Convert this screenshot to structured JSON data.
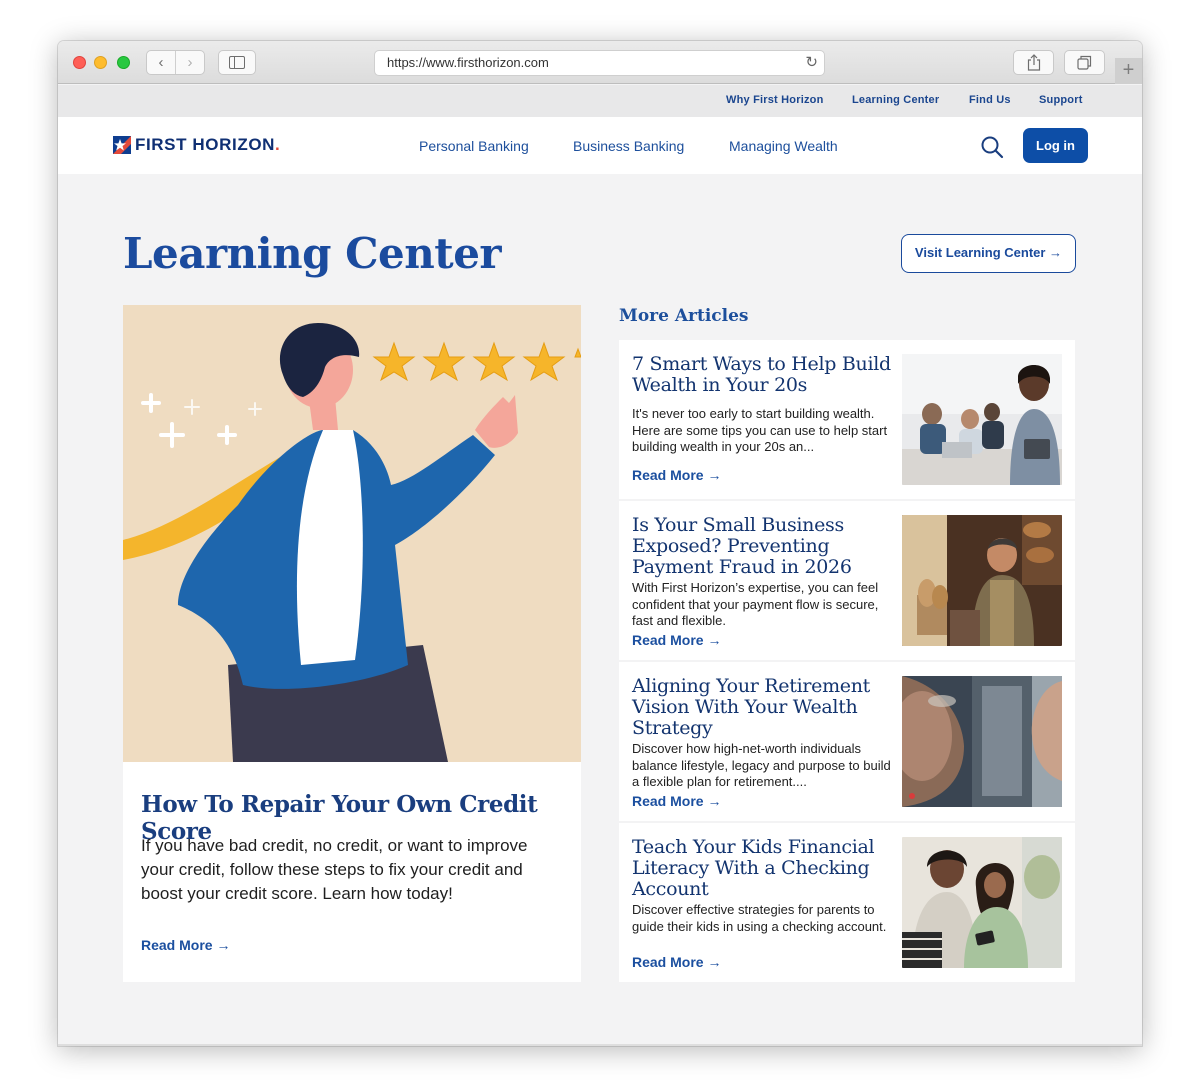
{
  "browser": {
    "url": "https://www.firsthorizon.com",
    "new_tab_glyph": "+"
  },
  "utility_nav": [
    {
      "label": "Why First Horizon"
    },
    {
      "label": "Learning Center"
    },
    {
      "label": "Find Us"
    },
    {
      "label": "Support"
    }
  ],
  "header": {
    "logo_text": "FIRST HORIZON",
    "logo_suffix": ".",
    "nav": [
      {
        "label": "Personal Banking"
      },
      {
        "label": "Business Banking"
      },
      {
        "label": "Managing Wealth"
      }
    ],
    "login_label": "Log in"
  },
  "learning_center": {
    "title": "Learning Center",
    "visit_label": "Visit Learning Center →",
    "featured": {
      "title": "How To Repair Your Own Credit Score",
      "description": "If you have bad credit, no credit, or want to improve your credit, follow these steps to fix your credit and boost your credit score. Learn how today!",
      "read_more": "Read More →",
      "rating_stars": 5
    },
    "more_title": "More Articles",
    "articles": [
      {
        "title": "7 Smart Ways to Help Build Wealth in Your 20s",
        "description": "It's never too early to start building wealth. Here are some tips you can use to help start building wealth in your 20s an...",
        "read_more": "Read More →"
      },
      {
        "title": "Is Your Small Business Exposed? Preventing Payment Fraud in 2026",
        "description": "With First Horizon’s expertise, you can feel confident that your payment flow is secure, fast and flexible.",
        "read_more": "Read More →"
      },
      {
        "title": "Aligning Your Retirement Vision With Your Wealth Strategy",
        "description": "Discover how high-net-worth individuals balance lifestyle, legacy and purpose to build a flexible plan for retirement....",
        "read_more": "Read More →"
      },
      {
        "title": "Teach Your Kids Financial Literacy With a Checking Account",
        "description": "Discover effective strategies for parents to guide their kids in using a checking account.",
        "read_more": "Read More →"
      }
    ]
  },
  "colors": {
    "brand_blue": "#0d4ea7",
    "heading_blue": "#1b4b9e",
    "logo_accent": "#e34a3a",
    "page_bg": "#f3f3f4"
  }
}
